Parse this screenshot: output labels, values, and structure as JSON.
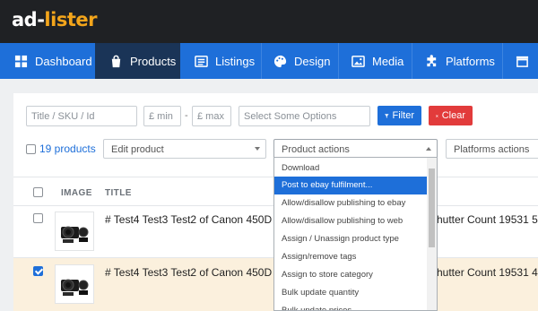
{
  "logo": {
    "part1": "ad-",
    "part2": "lister"
  },
  "nav": {
    "items": [
      {
        "label": "Dashboard",
        "icon": "grid-icon"
      },
      {
        "label": "Products",
        "icon": "bag-icon",
        "active": true
      },
      {
        "label": "Listings",
        "icon": "list-icon"
      },
      {
        "label": "Design",
        "icon": "palette-icon"
      },
      {
        "label": "Media",
        "icon": "image-icon"
      },
      {
        "label": "Platforms",
        "icon": "puzzle-icon"
      }
    ]
  },
  "filters": {
    "title_placeholder": "Title / SKU / Id",
    "min_placeholder": "£ min",
    "range_sep": "-",
    "max_placeholder": "£ max",
    "options_placeholder": "Select Some Options",
    "filter_label": "Filter",
    "clear_label": "Clear"
  },
  "toolbar": {
    "count_label": "19 products",
    "edit_select": "Edit product",
    "actions_select": "Product actions",
    "platforms_select": "Platforms actions"
  },
  "table": {
    "headers": {
      "image": "IMAGE",
      "title": "TITLE"
    },
    "rows": [
      {
        "title": "# Test4 Test3 Test2 of Canon 450D Di",
        "suffix": "hutter Count 19531 5",
        "checked": false
      },
      {
        "title": "# Test4 Test3 Test2 of Canon 450D Di",
        "suffix": "hutter Count 19531 4",
        "checked": true
      }
    ]
  },
  "dropdown": {
    "items": [
      "Download",
      "Post to ebay fulfilment...",
      "Allow/disallow publishing to ebay",
      "Allow/disallow publishing to web",
      "Assign / Unassign product type",
      "Assign/remove tags",
      "Assign to store category",
      "Bulk update quantity",
      "Bulk update prices"
    ],
    "highlighted_index": 1
  },
  "colors": {
    "nav_blue": "#1e6fd9",
    "nav_active": "#1a3457",
    "logo_orange": "#f3a51b",
    "clear_red": "#e23b3b",
    "row_highlight": "#fbf0dd"
  }
}
